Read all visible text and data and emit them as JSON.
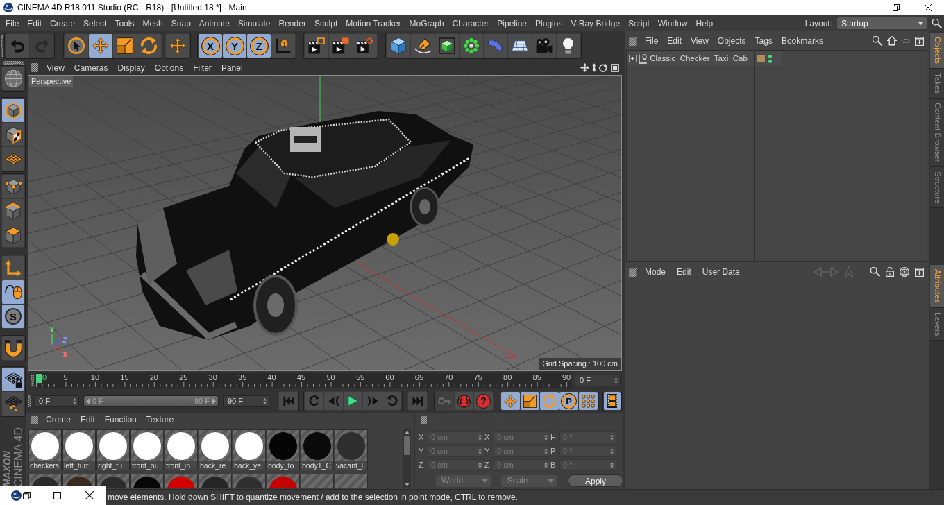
{
  "window": {
    "title": "CINEMA 4D R18.011 Studio (RC - R18) - [Untitled 18 *] - Main"
  },
  "menu_bar": {
    "items": [
      "File",
      "Edit",
      "Create",
      "Select",
      "Tools",
      "Mesh",
      "Snap",
      "Animate",
      "Simulate",
      "Render",
      "Sculpt",
      "Motion Tracker",
      "MoGraph",
      "Character",
      "Pipeline",
      "Plugins",
      "V-Ray Bridge",
      "Script",
      "Window",
      "Help"
    ],
    "layout_label": "Layout:",
    "layout": "Startup"
  },
  "toolbar": {
    "undo_redo": [
      {
        "disabled": false
      },
      {
        "disabled": true
      }
    ],
    "tools": [
      {
        "selected": false
      },
      {
        "selected": true
      },
      {
        "selected": false
      },
      {
        "selected": false
      },
      {
        "selected": false
      }
    ],
    "axes": [
      {
        "label": "X",
        "selected": true
      },
      {
        "label": "Y",
        "selected": true
      },
      {
        "label": "Z",
        "selected": true
      }
    ],
    "coordinate_system": {
      "selected": false
    }
  },
  "tool_palette": [
    {
      "selected": false
    },
    {
      "selected": true
    },
    {
      "selected": false
    },
    {
      "selected": false
    },
    {
      "selected": false
    },
    {
      "selected": false
    },
    {
      "selected": false
    },
    {
      "selected": false
    },
    {
      "selected": true
    },
    {
      "label": "S",
      "selected": true
    },
    {
      "selected": false
    },
    {
      "selected": true
    },
    {
      "selected": false
    }
  ],
  "logo": {
    "brand": "MAXON",
    "product": "CINEMA 4D"
  },
  "viewport": {
    "menu": [
      "View",
      "Cameras",
      "Display",
      "Options",
      "Filter",
      "Panel"
    ],
    "camera": "Perspective",
    "grid_spacing": "Grid Spacing : 100 cm",
    "axis_labels": [
      "Y",
      "Z",
      "X"
    ]
  },
  "timeline": {
    "ticks": [
      "0",
      "5",
      "10",
      "15",
      "20",
      "25",
      "30",
      "35",
      "40",
      "45",
      "50",
      "55",
      "60",
      "65",
      "70",
      "75",
      "80",
      "85",
      "90"
    ],
    "level": 0,
    "current_frame": "0 F"
  },
  "transport": {
    "start_frame": "0 F",
    "range": {
      "start": "0 F",
      "end": "90 F",
      "level": 1
    },
    "end_frame": "90 F",
    "keys": [
      {
        "disabled": true
      },
      {
        "disabled": false
      },
      {
        "label": "?",
        "disabled": false
      }
    ],
    "key_filters": [
      {
        "selected": true
      },
      {
        "selected": true
      },
      {
        "selected": true
      },
      {
        "label": "P",
        "selected": true
      },
      {
        "selected": true
      }
    ],
    "timeline_view": {
      "selected": true
    }
  },
  "material_manager": {
    "menu": [
      "Create",
      "Edit",
      "Function",
      "Texture"
    ],
    "materials": [
      {
        "kind": "sphere",
        "label": "checkers",
        "color": "#ffffff"
      },
      {
        "kind": "sphere",
        "label": "left_turr",
        "color": "#ffffff"
      },
      {
        "kind": "sphere",
        "label": "right_tu",
        "color": "#ffffff"
      },
      {
        "kind": "sphere",
        "label": "front_ou",
        "color": "#ffffff"
      },
      {
        "kind": "sphere",
        "label": "front_in",
        "color": "#ffffff"
      },
      {
        "kind": "sphere",
        "label": "back_re",
        "color": "#ffffff"
      },
      {
        "kind": "sphere",
        "label": "back_ye",
        "color": "#ffffff"
      },
      {
        "kind": "sphere",
        "label": "body_to",
        "color": "#050505"
      },
      {
        "kind": "sphere",
        "label": "body1_C",
        "color": "#0a0a0a"
      },
      {
        "kind": "sphere",
        "label": "vacant_l",
        "color": "#2e2e2e"
      },
      {
        "kind": "sphere",
        "color": "#2a2a2a"
      },
      {
        "kind": "sphere",
        "color": "#3b2a1c"
      },
      {
        "kind": "sphere",
        "color": "#2c2c2c"
      },
      {
        "kind": "sphere",
        "color": "#080808"
      },
      {
        "kind": "sphere",
        "color": "#d40000"
      },
      {
        "kind": "sphere",
        "color": "#262626"
      },
      {
        "kind": "sphere",
        "color": "#303030"
      },
      {
        "kind": "sphere",
        "color": "#c40000"
      },
      {
        "kind": "empty"
      },
      {
        "kind": "empty"
      }
    ]
  },
  "coordinates": {
    "headers": [
      "--",
      "--",
      "--"
    ],
    "disabled": true,
    "rows": [
      [
        {
          "axis": "X",
          "value": "0 cm"
        },
        {
          "axis": "X",
          "value": "0 cm"
        },
        {
          "axis": "H",
          "value": "0 °"
        }
      ],
      [
        {
          "axis": "Y",
          "value": "0 cm"
        },
        {
          "axis": "Y",
          "value": "0 cm"
        },
        {
          "axis": "P",
          "value": "0 °"
        }
      ],
      [
        {
          "axis": "Z",
          "value": "0 cm"
        },
        {
          "axis": "Z",
          "value": "0 cm"
        },
        {
          "axis": "B",
          "value": "0 °"
        }
      ]
    ],
    "dropdowns": [
      "World",
      "Scale"
    ],
    "apply": "Apply"
  },
  "object_manager": {
    "menu": [
      "File",
      "Edit",
      "View",
      "Objects",
      "Tags",
      "Bookmarks"
    ],
    "objects": [
      {
        "name": "Classic_Checker_Taxi_Cab",
        "expanded": false,
        "color": "#ad8d5c"
      }
    ]
  },
  "attributes": {
    "menu": [
      "Mode",
      "Edit",
      "User Data"
    ]
  },
  "side_tabs": {
    "upper": [
      {
        "label": "Objects",
        "selected": true
      },
      {
        "label": "Takes",
        "selected": false
      },
      {
        "label": "Content Browser",
        "selected": false
      },
      {
        "label": "Structure",
        "selected": false
      }
    ],
    "lower": [
      {
        "label": "Attributes",
        "selected": true
      },
      {
        "label": "Layers",
        "selected": false
      }
    ]
  },
  "status_bar": {
    "text": "move elements. Hold down SHIFT to quantize movement / add to the selection in point mode, CTRL to remove."
  }
}
